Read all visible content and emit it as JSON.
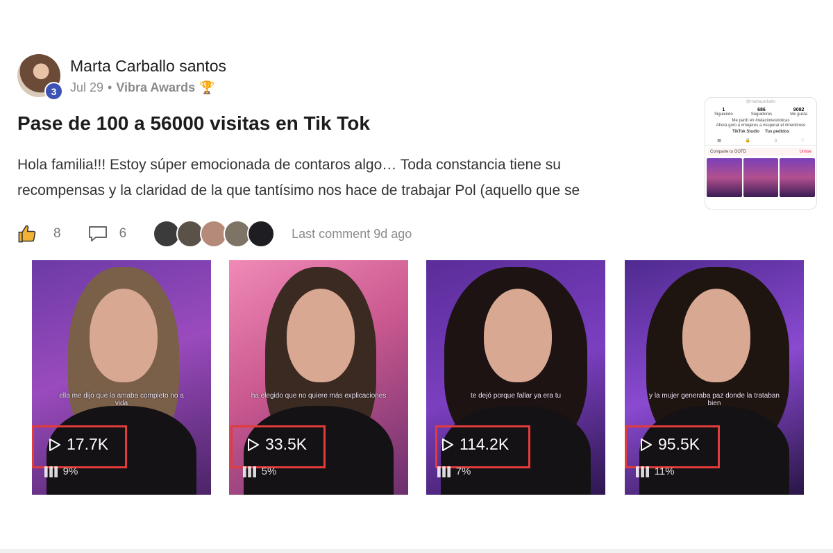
{
  "post": {
    "author": "Marta Carballo santos",
    "level": "3",
    "date": "Jul 29",
    "separator": "•",
    "category": "Vibra Awards",
    "category_icon": "trophy-icon",
    "title": "Pase de 100 a 56000 visitas en Tik Tok",
    "body_line1": "Hola familia!!! Estoy súper emocionada de contaros algo… Toda constancia tiene su",
    "body_line2": "recompensas y la claridad de la que tantísimo nos hace de trabajar Pol (aquello que se"
  },
  "thumbnail": {
    "handle": "@martacarballo",
    "stats": [
      {
        "value": "1",
        "label": "Siguiendo"
      },
      {
        "value": "686",
        "label": "Seguidores"
      },
      {
        "value": "9082",
        "label": "Me gusta"
      }
    ],
    "bio_line1": "Me pardí en #relacionestoxicas",
    "bio_line2": "Ahora guío a #mujeres a #superar el #mentiroso",
    "link1": "TikTok Studio",
    "link2": "Tus pedidos",
    "share_text": "Comparte tu OOTD",
    "share_button": "Unirse"
  },
  "reactions": {
    "likes": "8",
    "comments": "6",
    "last_comment": "Last comment 9d ago"
  },
  "commenter_colors": [
    "#3b3b3b",
    "#5a5148",
    "#b58a78",
    "#7d7466",
    "#1e1e22"
  ],
  "videos": [
    {
      "views": "17.7K",
      "percent": "9%",
      "caption": "ella me dijo que la amaba completo no a vida"
    },
    {
      "views": "33.5K",
      "percent": "5%",
      "caption": "ha elegido que no quiere más explicaciones"
    },
    {
      "views": "114.2K",
      "percent": "7%",
      "caption": "te dejó porque fallar ya era tu"
    },
    {
      "views": "95.5K",
      "percent": "11%",
      "caption": "y la mujer generaba paz donde la trataban bien"
    }
  ],
  "colors": {
    "highlight_box": "#e23b3b",
    "level_badge": "#3d52b5"
  }
}
